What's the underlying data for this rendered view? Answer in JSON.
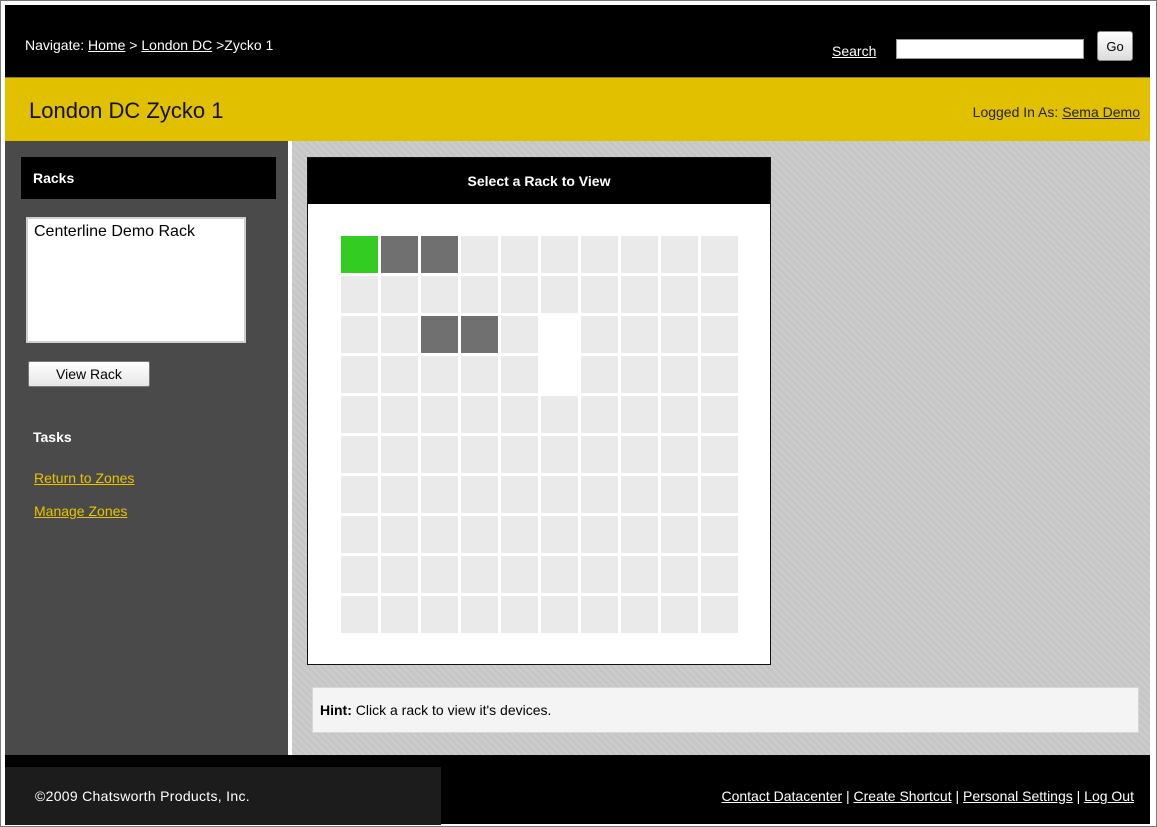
{
  "nav": {
    "prefix": "Navigate: ",
    "crumb_home": "Home",
    "sep1": " > ",
    "crumb_london": "London DC",
    "sep2": " >",
    "current": "Zycko 1",
    "search_label": "Search",
    "search_value": "",
    "go_label": "Go"
  },
  "header": {
    "title": "London DC Zycko 1",
    "logged_in_prefix": "Logged In As: ",
    "user_name": "Sema Demo"
  },
  "sidebar": {
    "racks_title": "Racks",
    "rack_options": [
      "Centerline Demo Rack"
    ],
    "view_rack_label": "View Rack",
    "tasks_title": "Tasks",
    "return_link": "Return to Zones",
    "manage_link": "Manage Zones"
  },
  "rack_panel": {
    "title": "Select a Rack to View",
    "rows": 10,
    "cols": 10,
    "colors": {
      "empty": "#eaeaea",
      "rack": "#707070",
      "selected": "#33cc22"
    },
    "cell_states": [
      [
        "selected",
        "rack",
        "rack",
        "empty",
        "empty",
        "empty",
        "empty",
        "empty",
        "empty",
        "empty"
      ],
      [
        "empty",
        "empty",
        "empty",
        "empty",
        "empty",
        "empty",
        "empty",
        "empty",
        "empty",
        "empty"
      ],
      [
        "empty",
        "empty",
        "rack",
        "rack",
        "empty",
        "none",
        "empty",
        "empty",
        "empty",
        "empty"
      ],
      [
        "empty",
        "empty",
        "empty",
        "empty",
        "empty",
        "none",
        "empty",
        "empty",
        "empty",
        "empty"
      ],
      [
        "empty",
        "empty",
        "empty",
        "empty",
        "empty",
        "empty",
        "empty",
        "empty",
        "empty",
        "empty"
      ],
      [
        "empty",
        "empty",
        "empty",
        "empty",
        "empty",
        "empty",
        "empty",
        "empty",
        "empty",
        "empty"
      ],
      [
        "empty",
        "empty",
        "empty",
        "empty",
        "empty",
        "empty",
        "empty",
        "empty",
        "empty",
        "empty"
      ],
      [
        "empty",
        "empty",
        "empty",
        "empty",
        "empty",
        "empty",
        "empty",
        "empty",
        "empty",
        "empty"
      ],
      [
        "empty",
        "empty",
        "empty",
        "empty",
        "empty",
        "empty",
        "empty",
        "empty",
        "empty",
        "empty"
      ],
      [
        "empty",
        "empty",
        "empty",
        "empty",
        "empty",
        "empty",
        "empty",
        "empty",
        "empty",
        "empty"
      ]
    ]
  },
  "hint": {
    "label": "Hint:",
    "text": " Click a rack to view it's devices."
  },
  "footer": {
    "copyright": "©2009 Chatsworth Products, Inc.",
    "links": {
      "contact": "Contact Datacenter",
      "shortcut": "Create Shortcut",
      "settings": "Personal Settings",
      "logout": "Log Out"
    },
    "separator": " | "
  }
}
